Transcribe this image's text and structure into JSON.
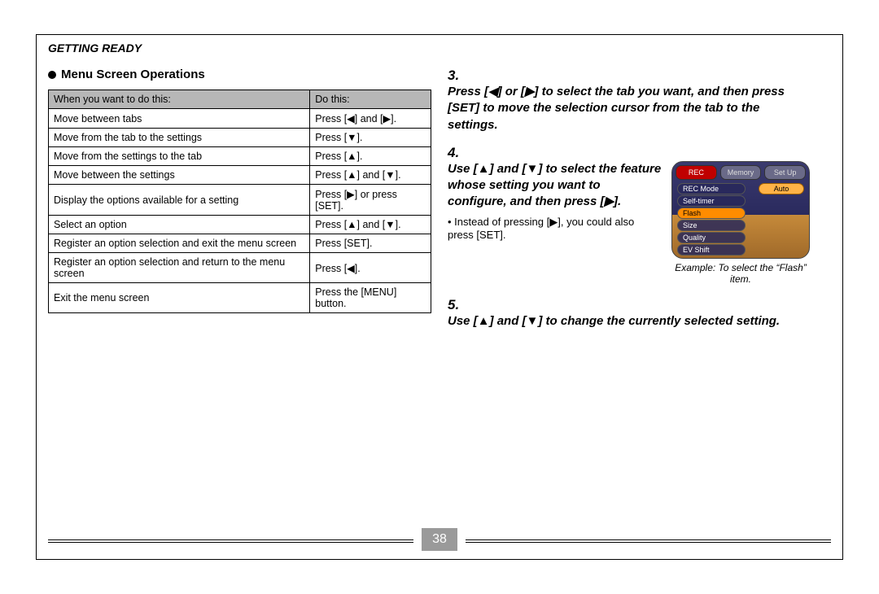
{
  "page_number": "38",
  "section_title": "GETTING READY",
  "left": {
    "subheading": "Menu Screen Operations",
    "table": {
      "headers": [
        "When you want to do this:",
        "Do this:"
      ],
      "rows": [
        [
          "Move between tabs",
          "Press [◀] and [▶]."
        ],
        [
          "Move from the tab to the settings",
          "Press [▼]."
        ],
        [
          "Move from the settings to the tab",
          "Press [▲]."
        ],
        [
          "Move between the settings",
          "Press [▲] and [▼]."
        ],
        [
          "Display the options available for a setting",
          "Press [▶] or press [SET]."
        ],
        [
          "Select an option",
          "Press [▲] and [▼]."
        ],
        [
          "Register an option selection and exit the menu screen",
          "Press [SET]."
        ],
        [
          "Register an option selection and return to the menu screen",
          "Press [◀]."
        ],
        [
          "Exit the menu screen",
          "Press the [MENU] button."
        ]
      ]
    }
  },
  "right": {
    "step3": {
      "num": "3.",
      "text": "Press [◀] or [▶] to select the tab you want, and then press [SET] to move the selection cursor from the tab to the settings."
    },
    "step4": {
      "num": "4.",
      "text": "Use [▲] and [▼] to select the feature whose setting you want to configure, and then press [▶].",
      "sub": "Instead of pressing [▶], you could also press [SET].",
      "caption": "Example: To select the “Flash” item.",
      "screen": {
        "tabs": [
          "REC",
          "Memory",
          "Set Up"
        ],
        "active_tab": 0,
        "menu": [
          "REC Mode",
          "Self-timer",
          "Flash",
          "Size",
          "Quality",
          "EV Shift"
        ],
        "selected_index": 2,
        "option": "Auto"
      }
    },
    "step5": {
      "num": "5.",
      "text": "Use [▲] and [▼] to change the currently selected setting."
    }
  }
}
